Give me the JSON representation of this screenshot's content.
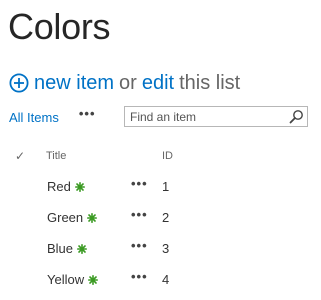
{
  "list": {
    "title": "Colors"
  },
  "actions": {
    "new_item": "new item",
    "or": "or",
    "edit": "edit",
    "this_list": "this list"
  },
  "view": {
    "label": "All Items",
    "menu": "•••"
  },
  "search": {
    "placeholder": "Find an item"
  },
  "columns": {
    "check": "✓",
    "title": "Title",
    "id": "ID"
  },
  "rows": [
    {
      "title": "Red",
      "menu": "•••",
      "id": "1",
      "new": true
    },
    {
      "title": "Green",
      "menu": "•••",
      "id": "2",
      "new": true
    },
    {
      "title": "Blue",
      "menu": "•••",
      "id": "3",
      "new": true
    },
    {
      "title": "Yellow",
      "menu": "•••",
      "id": "4",
      "new": true
    }
  ],
  "colors": {
    "link": "#0072c6",
    "new_badge": "#3a9a22",
    "title_text": "#262626"
  },
  "icons": {
    "add": "circle-plus-icon",
    "search": "magnifier-icon",
    "new": "new-item-sparkle-icon"
  }
}
